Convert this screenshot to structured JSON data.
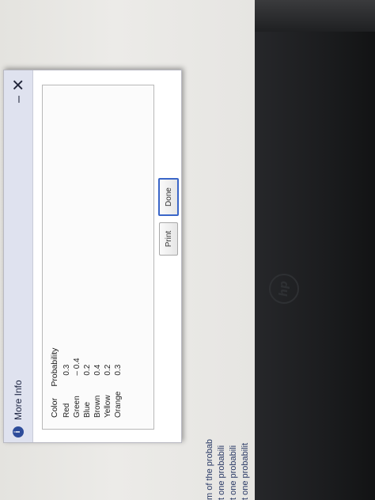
{
  "background": {
    "lines": [
      "t one probabilit",
      "t one probabili",
      "t one probabili",
      "m of the probab"
    ]
  },
  "dialog": {
    "icon": "info-icon",
    "title": "More Info",
    "minimize_label": "–",
    "close_label": "✕",
    "table": {
      "headers": [
        "Color",
        "Probability"
      ],
      "rows": [
        [
          "Red",
          "0.3"
        ],
        [
          "Green",
          "– 0.4"
        ],
        [
          "Blue",
          "0.2"
        ],
        [
          "Brown",
          "0.4"
        ],
        [
          "Yellow",
          "0.2"
        ],
        [
          "Orange",
          "0.3"
        ]
      ]
    },
    "buttons": {
      "print": "Print",
      "done": "Done"
    }
  },
  "device": {
    "logo": "hp"
  },
  "colors": {
    "titlebar": "#dfe2ef",
    "accent": "#3a66c8",
    "icon": "#2e4c9a"
  }
}
